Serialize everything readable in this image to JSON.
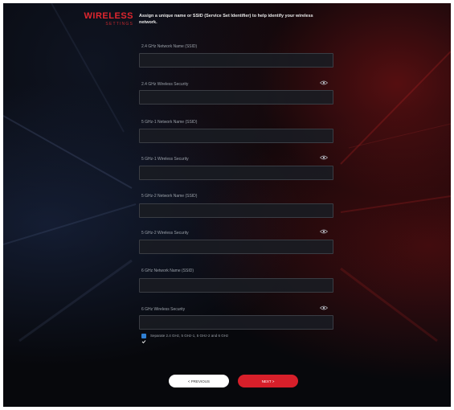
{
  "branding": {
    "logo_main": "WIRELESS",
    "logo_sub": "SETTINGS"
  },
  "intro": "Assign a unique name or SSID (Service Set Identifier) to help identify your wireless network.",
  "fields": [
    {
      "label": "2.4 GHz Network Name (SSID)",
      "value": "",
      "has_eye": false
    },
    {
      "label": "2.4 GHz Wireless Security",
      "value": "",
      "has_eye": true
    },
    {
      "label": "5 GHz-1 Network Name (SSID)",
      "value": "",
      "has_eye": false
    },
    {
      "label": "5 GHz-1 Wireless Security",
      "value": "",
      "has_eye": true
    },
    {
      "label": "5 GHz-2 Network Name (SSID)",
      "value": "",
      "has_eye": false
    },
    {
      "label": "5 GHz-2 Wireless Security",
      "value": "",
      "has_eye": true
    },
    {
      "label": "6 GHz Network Name (SSID)",
      "value": "",
      "has_eye": false
    },
    {
      "label": "6 GHz Wireless Security",
      "value": "",
      "has_eye": true
    }
  ],
  "separate_option": {
    "label": "Separate 2.4 GHz, 5 GHz-1, 5 GHz-2 and 6 GHz",
    "checked": true
  },
  "buttons": {
    "previous": "< PREVIOUS",
    "next": "NEXT >"
  },
  "colors": {
    "accent": "#d71f2a",
    "checkbox": "#2f7fd4",
    "background": "#07080c"
  }
}
